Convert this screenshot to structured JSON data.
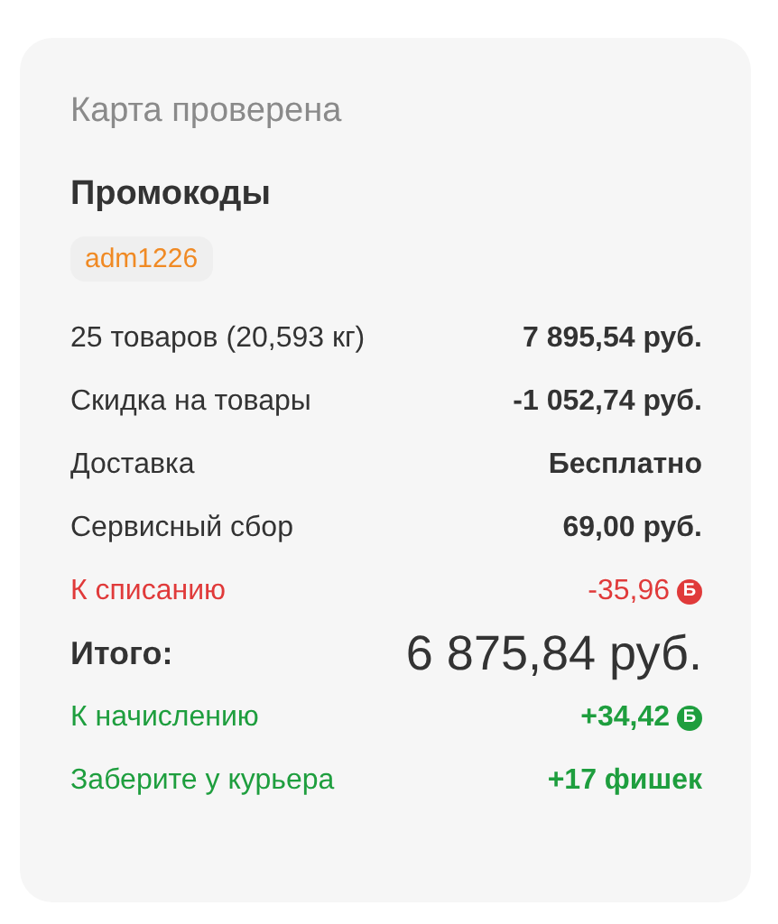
{
  "status": "Карта проверена",
  "promo": {
    "title": "Промокоды",
    "codes": [
      "adm1226"
    ]
  },
  "rows": [
    {
      "kind": "regular",
      "label": "25 товаров (20,593 кг)",
      "value": "7 895,54 руб."
    },
    {
      "kind": "regular",
      "label": "Скидка на товары",
      "value": "-1 052,74 руб."
    },
    {
      "kind": "regular",
      "label": "Доставка",
      "value": "Бесплатно"
    },
    {
      "kind": "regular",
      "label": "Сервисный сбор",
      "value": "69,00 руб."
    },
    {
      "kind": "debit",
      "label": "К списанию",
      "value": "-35,96",
      "mark": "Б"
    },
    {
      "kind": "total",
      "label": "Итого:",
      "value": "6 875,84 руб."
    },
    {
      "kind": "credit",
      "label": "К начислению",
      "value": "+34,42",
      "mark": "Б"
    },
    {
      "kind": "credit",
      "label": "Заберите у курьера",
      "value": "+17 фишек"
    }
  ]
}
